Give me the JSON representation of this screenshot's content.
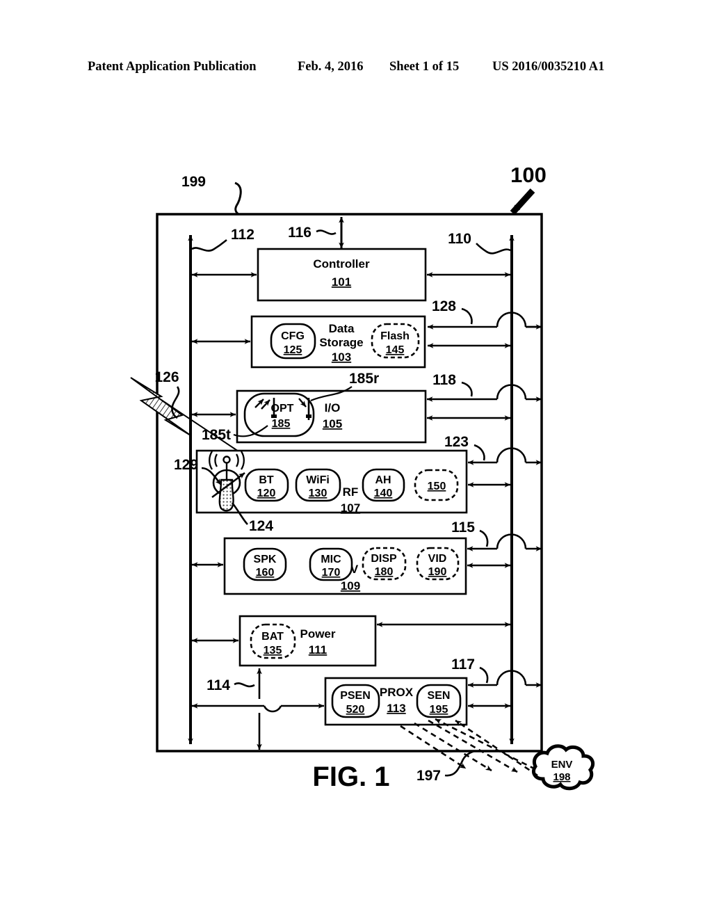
{
  "header": {
    "publication": "Patent Application Publication",
    "date": "Feb. 4, 2016",
    "sheet": "Sheet 1 of 15",
    "patent_number": "US 2016/0035210 A1"
  },
  "figure": {
    "caption": "FIG.  1",
    "device_label": "100",
    "enclosure_label": "199"
  },
  "blocks": [
    {
      "id": "controller",
      "title": "Controller",
      "ref": "101",
      "style": "solid"
    },
    {
      "id": "data-storage",
      "title": "Data Storage",
      "ref": "103",
      "style": "solid"
    },
    {
      "id": "io",
      "title": "I/O",
      "ref": "105",
      "style": "solid"
    },
    {
      "id": "rf",
      "title": "RF",
      "ref": "107",
      "style": "solid"
    },
    {
      "id": "av",
      "title": "AV",
      "ref": "109",
      "style": "solid"
    },
    {
      "id": "power",
      "title": "Power",
      "ref": "111",
      "style": "solid"
    },
    {
      "id": "prox",
      "title": "PROX",
      "ref": "113",
      "style": "solid"
    }
  ],
  "sub_blocks": [
    {
      "id": "cfg",
      "title": "CFG",
      "ref": "125",
      "parent": "data-storage",
      "style": "solid"
    },
    {
      "id": "flash",
      "title": "Flash",
      "ref": "145",
      "parent": "data-storage",
      "style": "dashed"
    },
    {
      "id": "opt",
      "title": "OPT",
      "ref": "185",
      "parent": "io",
      "style": "solid"
    },
    {
      "id": "bt",
      "title": "BT",
      "ref": "120",
      "parent": "rf",
      "style": "solid"
    },
    {
      "id": "wifi",
      "title": "WiFi",
      "ref": "130",
      "parent": "rf",
      "style": "solid"
    },
    {
      "id": "ah",
      "title": "AH",
      "ref": "140",
      "parent": "rf",
      "style": "solid"
    },
    {
      "id": "rf150",
      "title": "",
      "ref": "150",
      "parent": "rf",
      "style": "dashed"
    },
    {
      "id": "spk",
      "title": "SPK",
      "ref": "160",
      "parent": "av",
      "style": "solid"
    },
    {
      "id": "mic",
      "title": "MIC",
      "ref": "170",
      "parent": "av",
      "style": "solid"
    },
    {
      "id": "disp",
      "title": "DISP",
      "ref": "180",
      "parent": "av",
      "style": "dashed"
    },
    {
      "id": "vid",
      "title": "VID",
      "ref": "190",
      "parent": "av",
      "style": "dashed"
    },
    {
      "id": "bat",
      "title": "BAT",
      "ref": "135",
      "parent": "power",
      "style": "dashed"
    },
    {
      "id": "psen",
      "title": "PSEN",
      "ref": "520",
      "parent": "prox",
      "style": "solid"
    },
    {
      "id": "sen",
      "title": "SEN",
      "ref": "195",
      "parent": "prox",
      "style": "solid"
    }
  ],
  "environment": {
    "title": "ENV",
    "ref": "198",
    "link_ref": "197"
  },
  "callouts": [
    {
      "id": "c199",
      "label": "199"
    },
    {
      "id": "c100",
      "label": "100"
    },
    {
      "id": "c112",
      "label": "112"
    },
    {
      "id": "c116",
      "label": "116"
    },
    {
      "id": "c110",
      "label": "110"
    },
    {
      "id": "c128",
      "label": "128"
    },
    {
      "id": "c126",
      "label": "126"
    },
    {
      "id": "c118",
      "label": "118"
    },
    {
      "id": "c185r",
      "label": "185r"
    },
    {
      "id": "c185t",
      "label": "185t"
    },
    {
      "id": "c123",
      "label": "123"
    },
    {
      "id": "c129",
      "label": "129"
    },
    {
      "id": "c124",
      "label": "124"
    },
    {
      "id": "c115",
      "label": "115"
    },
    {
      "id": "c117",
      "label": "117"
    },
    {
      "id": "c114",
      "label": "114"
    },
    {
      "id": "c197",
      "label": "197"
    }
  ]
}
